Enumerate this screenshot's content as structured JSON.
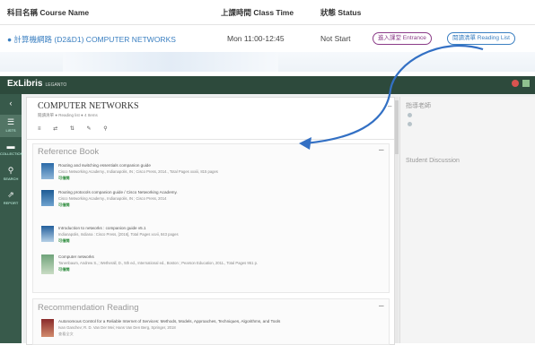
{
  "course_table": {
    "headers": {
      "name": "科目名稱 Course Name",
      "time": "上課時間 Class Time",
      "status": "狀態 Status"
    },
    "row": {
      "info_icon": "info-icon",
      "course": "計算機網路 (D2&D1) COMPUTER NETWORKS",
      "time": "Mon 11:00-12:45",
      "status": "Not Start",
      "entrance_btn": "進入課堂 Entrance",
      "reading_list_btn": "閱讀清單 Reading List"
    }
  },
  "app": {
    "brand": "ExLibris",
    "brand_sub": "LEGANTO",
    "sidebar": [
      {
        "icon": "‹",
        "label": ""
      },
      {
        "icon": "☰",
        "label": "LISTS"
      },
      {
        "icon": "▬",
        "label": "COLLECTION"
      },
      {
        "icon": "⚲",
        "label": "SEARCH"
      },
      {
        "icon": "⇗",
        "label": "REPORT"
      }
    ],
    "list": {
      "title": "COMPUTER NETWORKS",
      "subtitle": "閱讀清單 ● Reading list  ● 4 Items",
      "tools": "≡ ⇄ ⇅ ✎ ⚲"
    },
    "sections": [
      {
        "title": "Reference Book",
        "items": [
          {
            "title": "Routing and switching essentials companion guide",
            "sub": "Cisco Networking Academy., Indianapolis, IN ; Cisco Press, 2014., Total Pages xxxiii, 815 pages",
            "avail": "可借閱"
          },
          {
            "title": "Routing protocols companion guide / Cisco Networking Academy.",
            "sub": "Cisco Networking Academy., Indianapolis, IN ; Cisco Press, 2014",
            "avail": "可借閱"
          },
          {
            "title": "Introduction to networks : companion guide v5.1",
            "sub": "Indianapolis, Indiana : Cisco Press, [2016], Total Pages xxvii, 843 pages",
            "avail": "可借閱"
          },
          {
            "title": "Computer networks",
            "sub": "Tanenbaum, Andrew S.,; Wetherall, D., 5th ed., International ed., Boston ; Pearson Education, 2011., Total Pages 951 p.",
            "avail": "可借閱"
          }
        ]
      },
      {
        "title": "Recommendation Reading",
        "items": [
          {
            "title": "Autonomous Control for a Reliable Internet of Services: Methods, Models, Approaches, Techniques, Algorithms, and Tools",
            "sub": "Ivan Ganchev; R. D. Van Der Mei; Hans Van Den Berg, Springer, 2018",
            "avail": "查看全文"
          }
        ]
      }
    ],
    "right": {
      "teacher_title": "指導老師",
      "teachers": [
        "teacher-1",
        "teacher-2"
      ],
      "discussion_title": "Student Discussion"
    },
    "colors": {
      "topbar": "#2d4a3c",
      "sidebar": "#385a4b",
      "entrance": "#8b3c88",
      "reading": "#3a7fc1",
      "arrow": "#3370c4"
    }
  }
}
